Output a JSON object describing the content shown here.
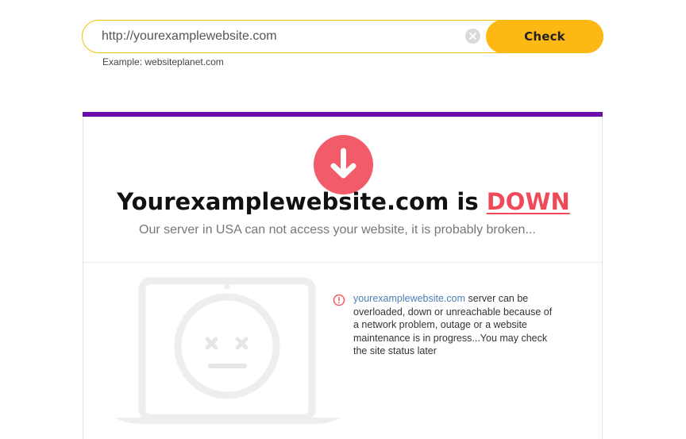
{
  "search": {
    "value": "http://yourexamplewebsite.com",
    "check_label": "Check",
    "example_label": "Example: websiteplanet.com"
  },
  "result": {
    "site_name": "Yourexamplewebsite.com",
    "is_label": " is ",
    "status_word": "DOWN",
    "subtitle": "Our server in USA can not access your website, it is probably broken...",
    "info_link": "yourexamplewebsite.com",
    "info_text": " server can be overloaded, down or unreachable because of a network problem, outage or a website maintenance is in progress...You may check the site status later"
  },
  "colors": {
    "accent_yellow": "#fdb813",
    "card_bar_purple": "#6a0dad",
    "down_red": "#f04a5a",
    "link_blue": "#4a7fb5"
  },
  "icons": {
    "clear": "close-circle-icon",
    "status": "arrow-down-icon",
    "info": "warning-circle-icon",
    "illustration": "laptop-sad-face-icon"
  }
}
